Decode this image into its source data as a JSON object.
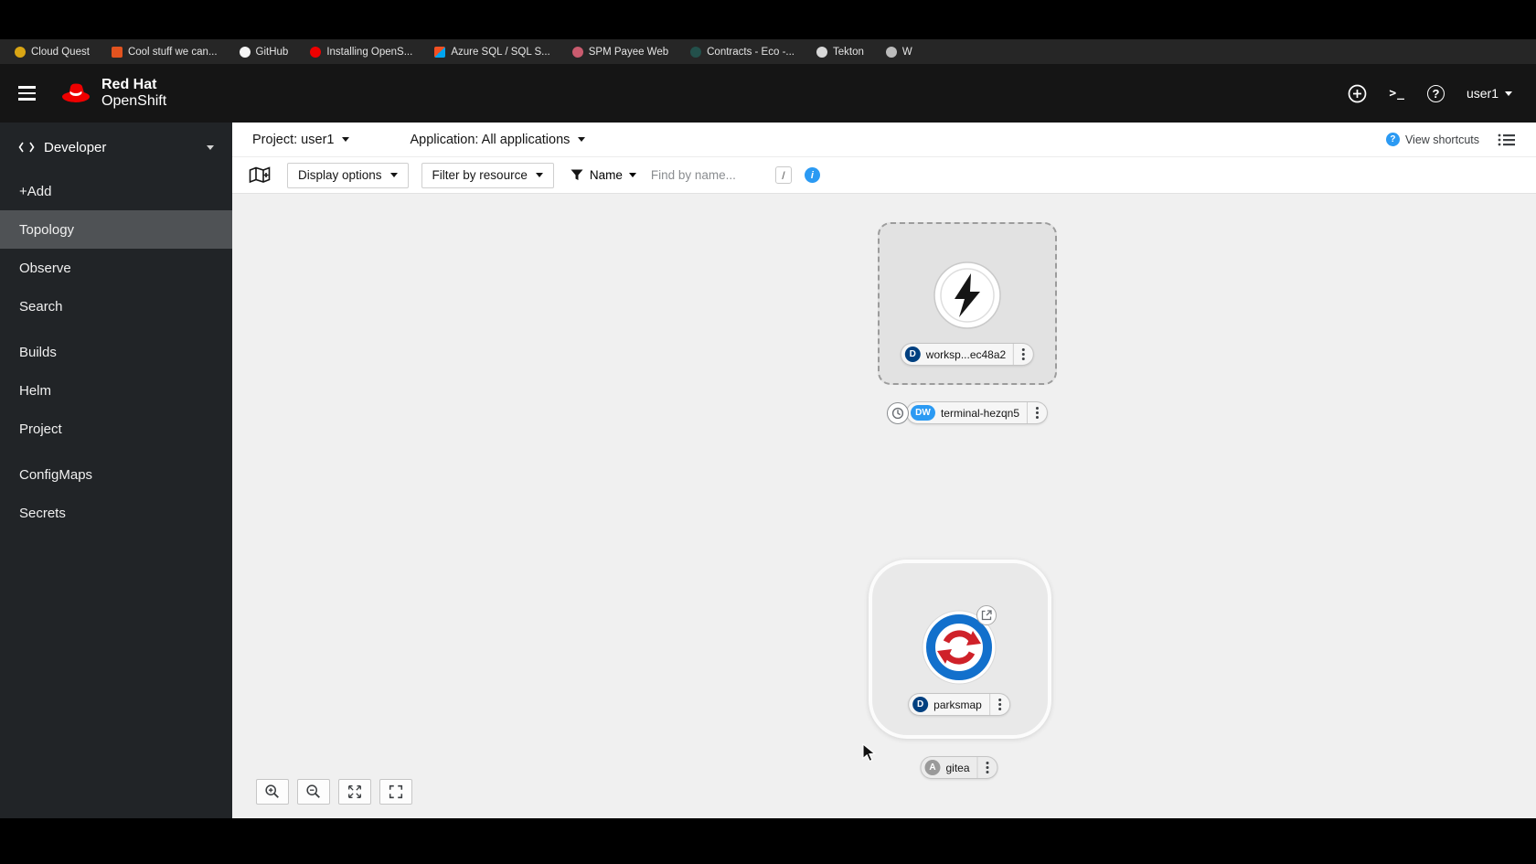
{
  "colors": {
    "masthead_bg": "#151515",
    "bookmarks_bg": "#262626",
    "sidebar_bg": "#212427",
    "sidebar_selected_bg": "#4f5255",
    "canvas_bg": "#f0f0f0",
    "info_blue": "#2b9af3",
    "badge_deployment_bg": "#004080",
    "badge_devworkspace_bg": "#2b9af3",
    "badge_application_bg": "#9a9a9a",
    "brand_red": "#ee0000"
  },
  "bookmarks": {
    "items": [
      {
        "label": "Cloud Quest",
        "icon": "cloud-quest-favicon",
        "icon_style": "background:#d9a514;border-radius:50%"
      },
      {
        "label": "Cool stuff we can...",
        "icon": "book-favicon",
        "icon_style": "background:#e2531f;border-radius:2px"
      },
      {
        "label": "GitHub",
        "icon": "github-favicon",
        "icon_style": "background:#f5f5f5;border-radius:50%"
      },
      {
        "label": "Installing OpenS...",
        "icon": "openshift-favicon",
        "icon_style": "background:#ee0000;border-radius:50%"
      },
      {
        "label": "Azure SQL / SQL S...",
        "icon": "azure-favicon",
        "icon_style": "background:linear-gradient(135deg,#f25022 50%,#00a4ef 50%);border-radius:2px"
      },
      {
        "label": "SPM Payee Web",
        "icon": "spm-favicon",
        "icon_style": "background:#c95b6e;border-radius:50%"
      },
      {
        "label": "Contracts - Eco -...",
        "icon": "contracts-favicon",
        "icon_style": "background:#23504b;border-radius:50%"
      },
      {
        "label": "Tekton",
        "icon": "tekton-favicon",
        "icon_style": "background:#d8d8d8;border-radius:50%"
      },
      {
        "label": "W",
        "icon": "globe-favicon",
        "icon_style": "background:#bbbbbb;border-radius:50%"
      }
    ]
  },
  "masthead": {
    "brand_top": "Red Hat",
    "brand_bottom": "OpenShift",
    "user": "user1"
  },
  "sidebar": {
    "perspective": "Developer",
    "items": [
      {
        "label": "+Add"
      },
      {
        "label": "Topology"
      },
      {
        "label": "Observe"
      },
      {
        "label": "Search"
      },
      {
        "label": "Builds"
      },
      {
        "label": "Helm"
      },
      {
        "label": "Project"
      },
      {
        "label": "ConfigMaps"
      },
      {
        "label": "Secrets"
      }
    ],
    "selected": "Topology"
  },
  "context_bar": {
    "project": "Project: user1",
    "application": "Application: All applications",
    "view_shortcuts": "View shortcuts"
  },
  "toolbar": {
    "display_options": "Display options",
    "filter_by_resource": "Filter by resource",
    "name_filter": "Name",
    "find_placeholder": "Find by name...",
    "shortcut_key": "/"
  },
  "topology": {
    "workspace_node": {
      "badge": "D",
      "label": "worksp...ec48a2"
    },
    "terminal_node": {
      "badge": "DW",
      "label": "terminal-hezqn5"
    },
    "parksmap_node": {
      "badge": "D",
      "label": "parksmap"
    },
    "gitea_node": {
      "badge": "A",
      "label": "gitea"
    }
  }
}
